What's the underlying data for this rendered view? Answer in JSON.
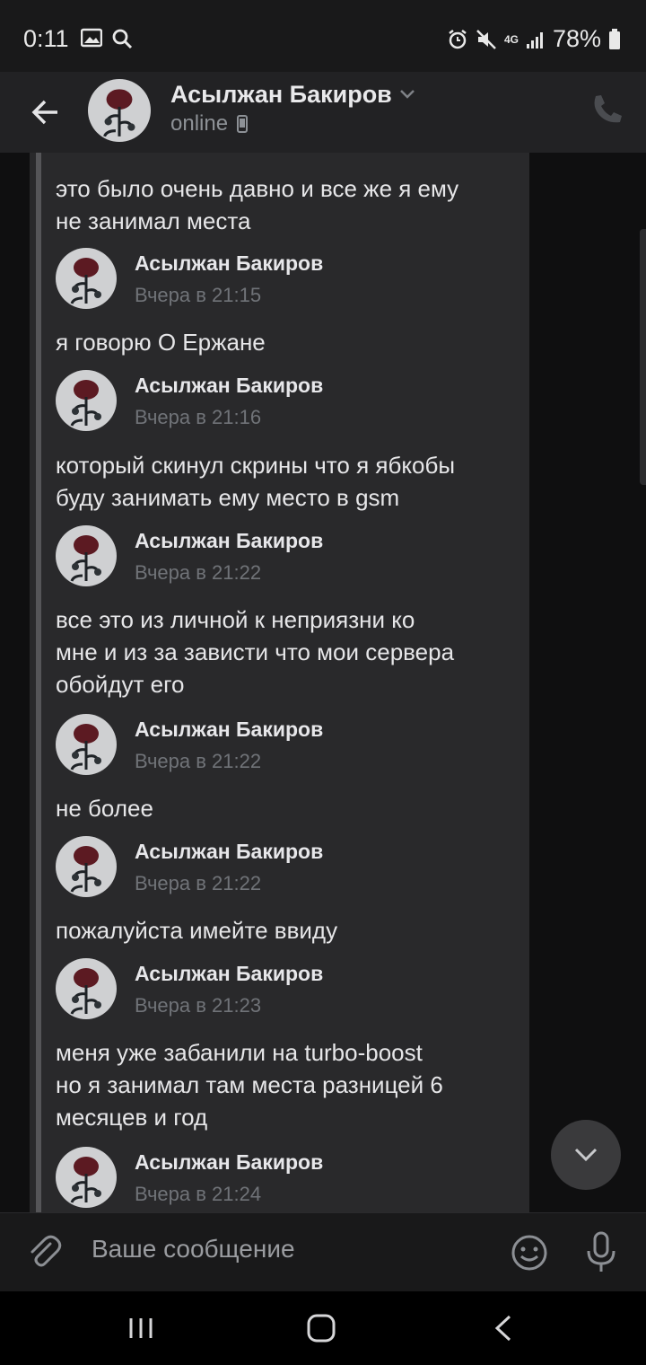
{
  "status_bar": {
    "time": "0:11",
    "network": "4G",
    "battery": "78%",
    "icons": [
      "image-icon",
      "search-icon",
      "alarm-icon",
      "mute-icon",
      "signal-icon",
      "battery-icon"
    ]
  },
  "header": {
    "name": "Асылжан Бакиров",
    "status": "online",
    "icons": [
      "back-arrow-icon",
      "chevron-down-icon",
      "mobile-icon",
      "phone-icon"
    ]
  },
  "messages": [
    {
      "type": "text",
      "text": "это было очень давно и все же я ему\nне занимал места"
    },
    {
      "type": "head",
      "sender": "Асылжан Бакиров",
      "time": "Вчера в 21:15"
    },
    {
      "type": "text",
      "text": "я говорю О Ержане"
    },
    {
      "type": "head",
      "sender": "Асылжан Бакиров",
      "time": "Вчера в 21:16"
    },
    {
      "type": "text",
      "text": "который скинул скрины что я ябкобы\nбуду занимать ему место в gsm"
    },
    {
      "type": "head",
      "sender": "Асылжан Бакиров",
      "time": "Вчера в 21:22"
    },
    {
      "type": "text",
      "text": "все это из личной к неприязни ко\nмне и из за зависти что мои сервера\nобойдут его"
    },
    {
      "type": "head",
      "sender": "Асылжан Бакиров",
      "time": "Вчера в 21:22"
    },
    {
      "type": "text",
      "text": "не более"
    },
    {
      "type": "head",
      "sender": "Асылжан Бакиров",
      "time": "Вчера в 21:22"
    },
    {
      "type": "text",
      "text": "пожалуйста имейте ввиду"
    },
    {
      "type": "head",
      "sender": "Асылжан Бакиров",
      "time": "Вчера в 21:23"
    },
    {
      "type": "text",
      "text": "меня уже забанили на turbo-boost\nно я занимал там места разницей 6\nмесяцев и год"
    },
    {
      "type": "head",
      "sender": "Асылжан Бакиров",
      "time": "Вчера в 21:24"
    }
  ],
  "composer": {
    "placeholder": "Ваше сообщение",
    "icons": [
      "paperclip-icon",
      "emoji-icon",
      "microphone-icon"
    ]
  },
  "navbar": {
    "icons": [
      "recents-icon",
      "home-icon",
      "back-icon"
    ]
  },
  "colors": {
    "background": "#19191a",
    "bubble": "#29292b",
    "accent_text": "#e1e3e6",
    "muted": "#707378"
  }
}
